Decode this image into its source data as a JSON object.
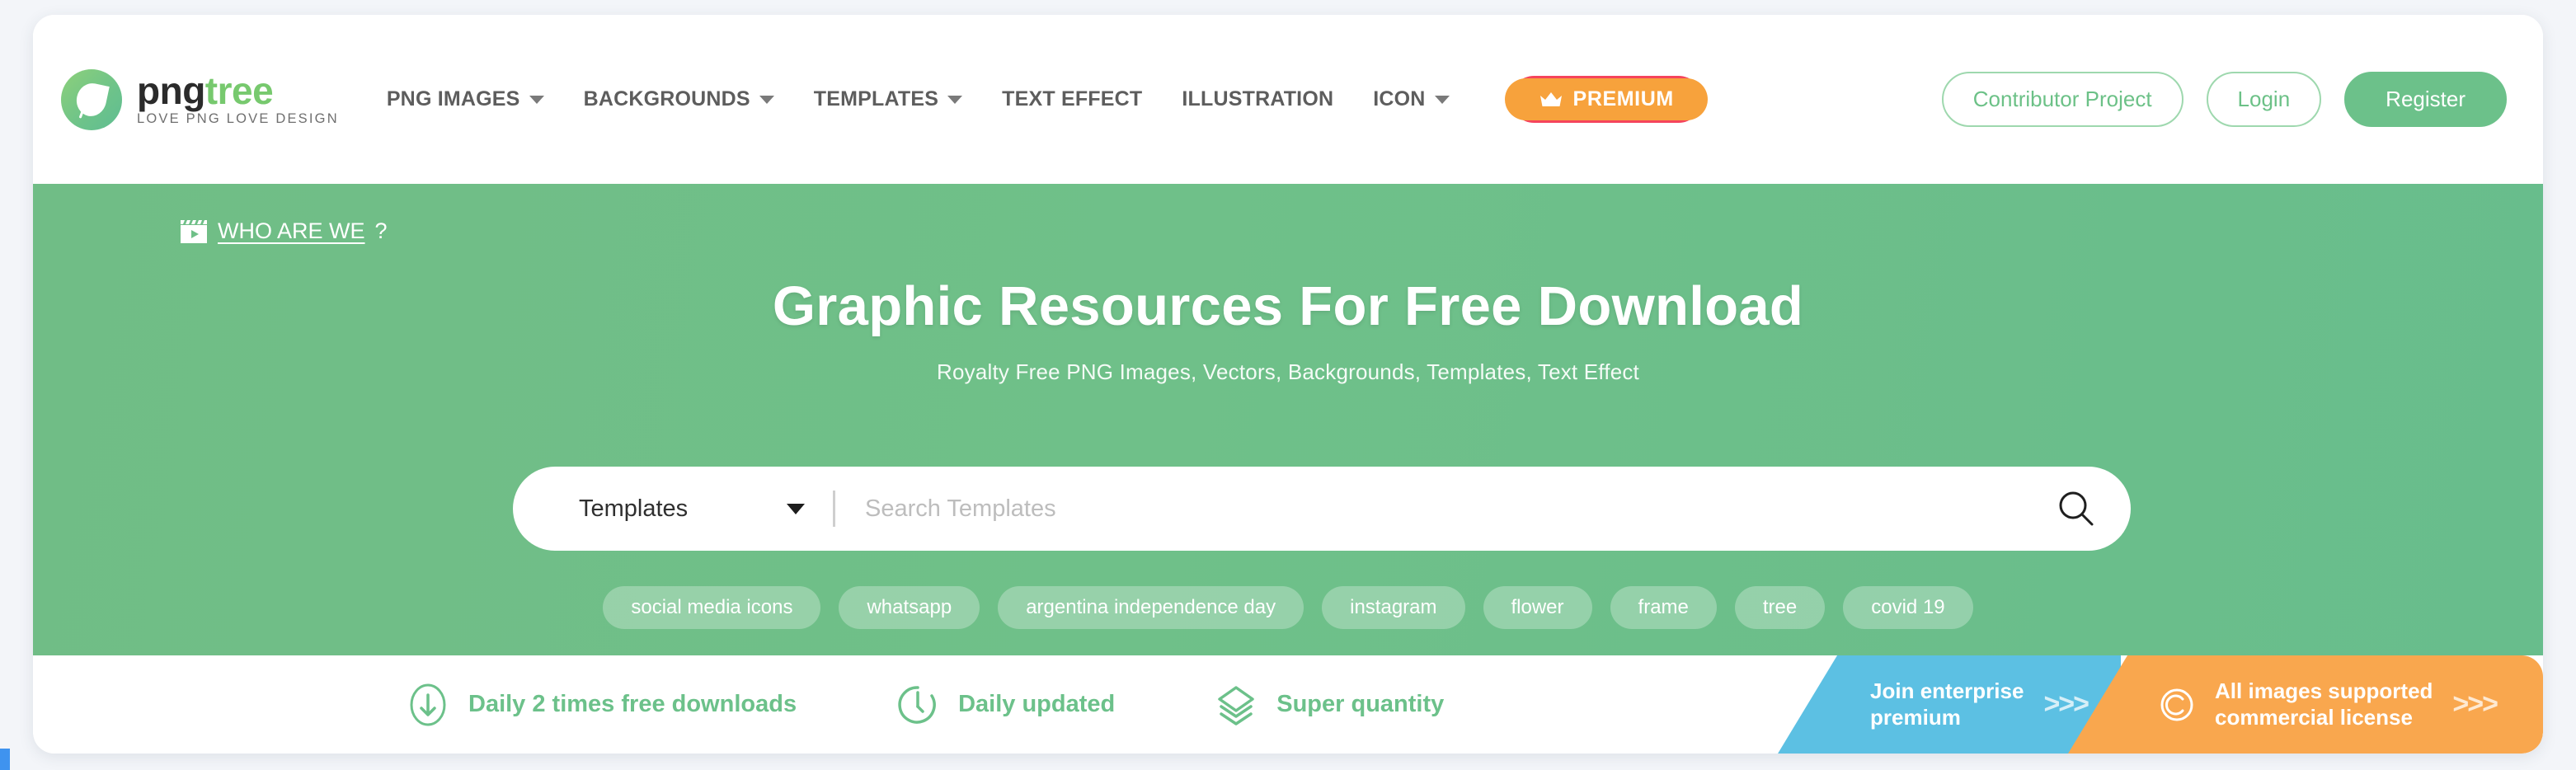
{
  "brand": {
    "logo_png": "png",
    "logo_tree": "tree",
    "tagline": "LOVE PNG LOVE DESIGN",
    "logo_icon": "leaf-circle-logo"
  },
  "nav": {
    "items": [
      {
        "label": "PNG IMAGES",
        "has_caret": true
      },
      {
        "label": "BACKGROUNDS",
        "has_caret": true
      },
      {
        "label": "TEMPLATES",
        "has_caret": true
      },
      {
        "label": "TEXT EFFECT",
        "has_caret": false
      },
      {
        "label": "ILLUSTRATION",
        "has_caret": false
      },
      {
        "label": "ICON",
        "has_caret": true
      }
    ],
    "premium_label": "PREMIUM",
    "premium_icon": "crown-icon",
    "premium_color": "#f5445c"
  },
  "actions": {
    "contributor": "Contributor Project",
    "login": "Login",
    "register": "Register",
    "accent": "#6cc18a"
  },
  "hero": {
    "who_icon": "clapperboard-icon",
    "who_link": "WHO ARE WE",
    "who_suffix": "?",
    "title": "Graphic Resources For Free Download",
    "subtitle": "Royalty Free PNG Images, Vectors, Backgrounds, Templates, Text Effect",
    "background": "#6fc088"
  },
  "search": {
    "category": "Templates",
    "placeholder": "Search Templates",
    "value": "",
    "icon": "search-icon"
  },
  "tags": [
    "social media icons",
    "whatsapp",
    "argentina independence day",
    "instagram",
    "flower",
    "frame",
    "tree",
    "covid 19"
  ],
  "features": [
    {
      "label": "Daily 2 times free downloads",
      "icon": "download-circle-icon"
    },
    {
      "label": "Daily updated",
      "icon": "clock-icon"
    },
    {
      "label": "Super quantity",
      "icon": "layers-icon"
    }
  ],
  "promos": [
    {
      "text": "Join enterprise\npremium",
      "chevrons": ">>>",
      "color": "#5cc0e3",
      "icon": ""
    },
    {
      "text": "All images supported\ncommercial license",
      "chevrons": ">>>",
      "color": "#f9a74e",
      "icon": "copyright-icon"
    }
  ]
}
